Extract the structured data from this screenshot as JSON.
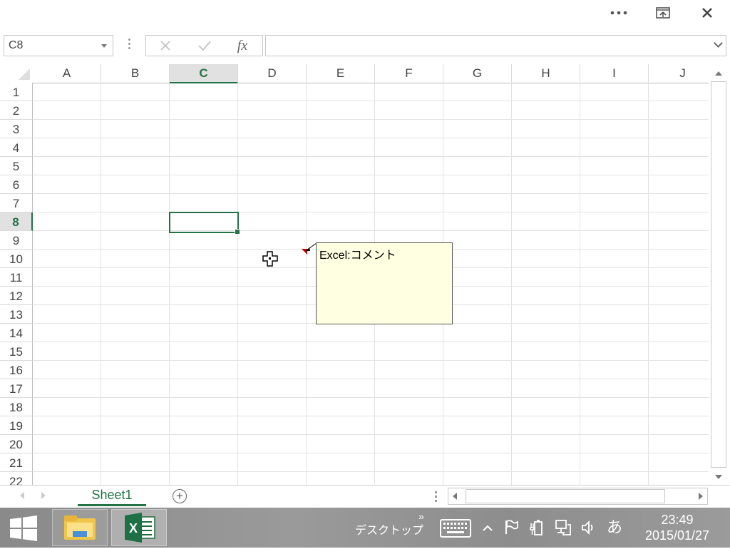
{
  "window": {
    "more_icon": "ellipsis-icon",
    "restore_icon": "restore-window-icon",
    "close_icon": "close-icon"
  },
  "formula_bar": {
    "name_box": "C8",
    "cancel_icon": "x-icon",
    "enter_icon": "checkmark-icon",
    "function_label": "fx",
    "formula": ""
  },
  "columns": [
    "A",
    "B",
    "C",
    "D",
    "E",
    "F",
    "G",
    "H",
    "I",
    "J"
  ],
  "rows": [
    "1",
    "2",
    "3",
    "4",
    "5",
    "6",
    "7",
    "8",
    "9",
    "10",
    "11",
    "12",
    "13",
    "14",
    "15",
    "16",
    "17",
    "18",
    "19",
    "20",
    "21",
    "22"
  ],
  "selected_column": "C",
  "selected_row": "8",
  "comment": {
    "text": "Excel:コメント",
    "indicator_color": "#c00000",
    "background": "#ffffe1"
  },
  "sheets": {
    "tabs": [
      "Sheet1"
    ],
    "active": "Sheet1",
    "add_label": "+"
  },
  "taskbar": {
    "apps": [
      "file-explorer-icon",
      "excel-icon"
    ],
    "desktop_label": "デスクトップ",
    "desktop_more": "»",
    "tray": {
      "ime_label": "あ"
    },
    "time": "23:49",
    "date": "2015/01/27"
  },
  "colors": {
    "accent": "#217346",
    "grid": "#e2e2e2",
    "taskbar": "#8f8f8f"
  }
}
